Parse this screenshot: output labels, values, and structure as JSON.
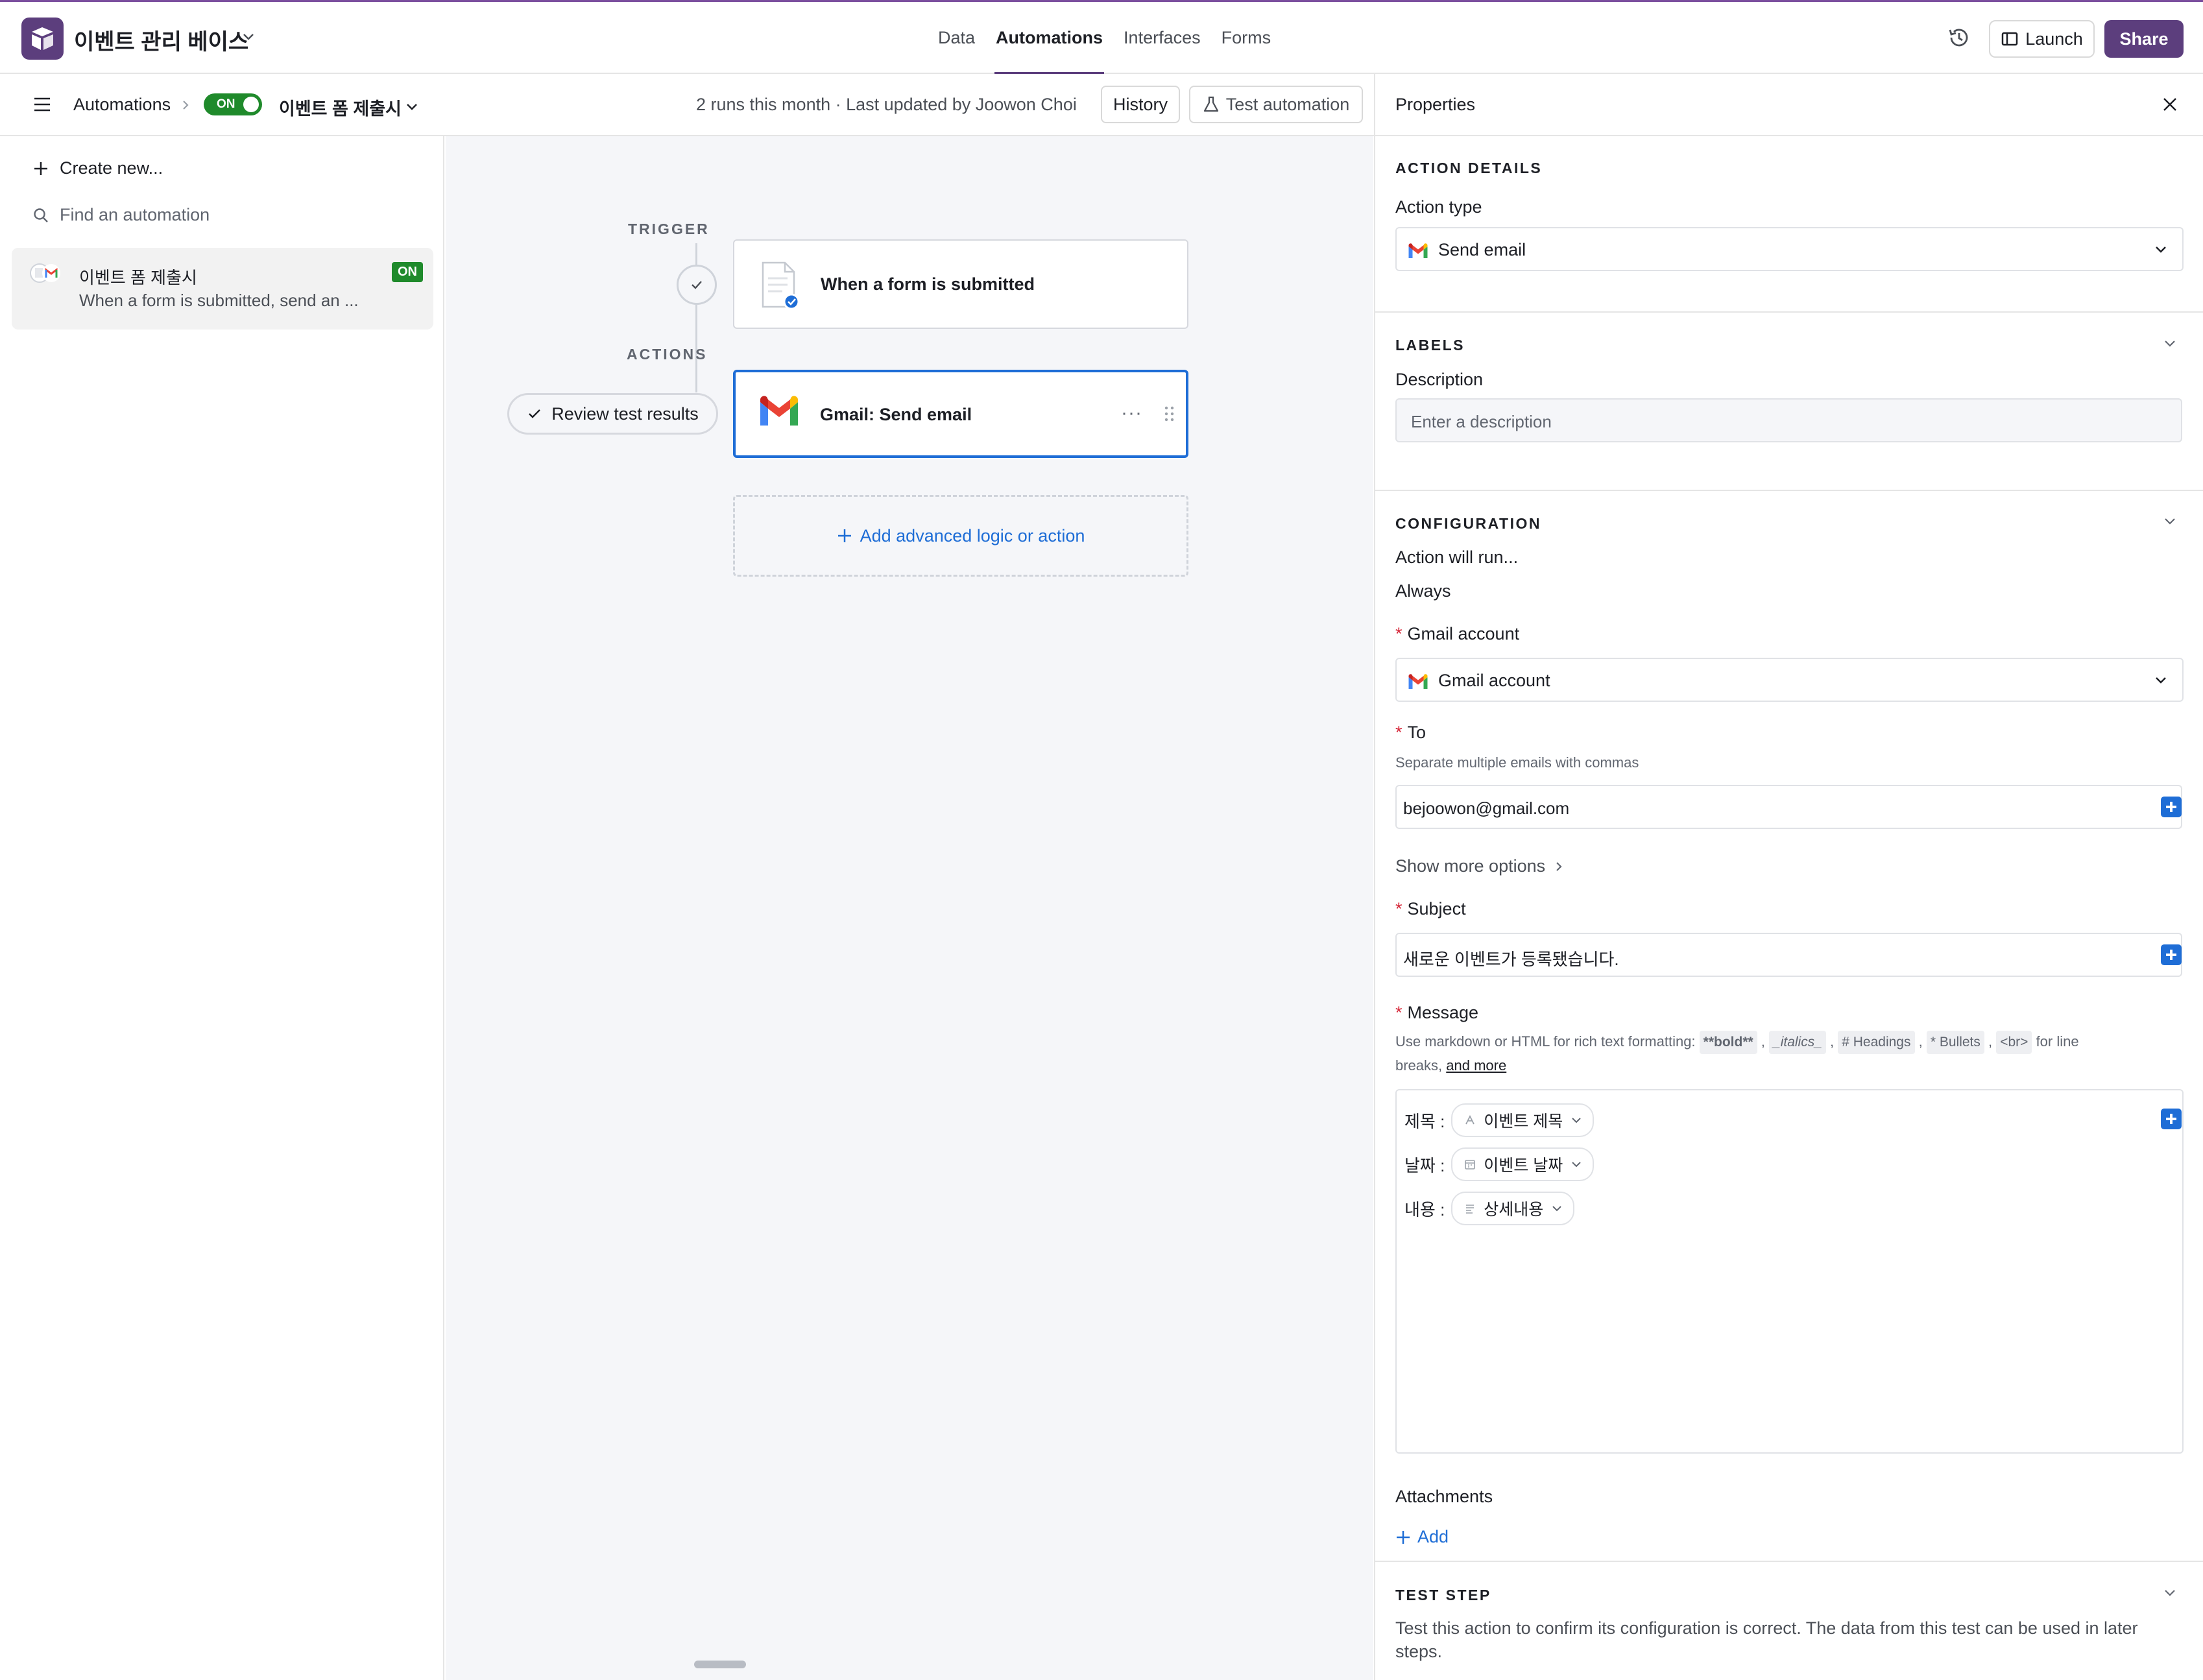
{
  "app": {
    "base_title": "이벤트 관리 베이스",
    "nav_tabs": [
      "Data",
      "Automations",
      "Interfaces",
      "Forms"
    ],
    "active_tab": "Automations",
    "launch_label": "Launch",
    "share_label": "Share",
    "brand_color": "#5c3e7d"
  },
  "subbar": {
    "crumb": "Automations",
    "toggle_label": "ON",
    "automation_name": "이벤트 폼 제출시",
    "runs_text": "2 runs this month · Last updated by Joowon Choi",
    "history_label": "History",
    "test_label": "Test automation"
  },
  "sidebar": {
    "create_new": "Create new...",
    "find_placeholder": "Find an automation",
    "items": [
      {
        "title": "이벤트 폼 제출시",
        "subtitle": "When a form is submitted, send an ...",
        "badge": "ON"
      }
    ]
  },
  "canvas": {
    "trigger_label": "TRIGGER",
    "actions_label": "ACTIONS",
    "trigger_text": "When a form is submitted",
    "action_text": "Gmail: Send email",
    "review_label": "Review test results",
    "add_logic_label": "Add advanced logic or action"
  },
  "props": {
    "title": "Properties",
    "action_details": {
      "section": "ACTION DETAILS",
      "action_type_label": "Action type",
      "action_type_value": "Send email"
    },
    "labels": {
      "section": "LABELS",
      "description_label": "Description",
      "description_placeholder": "Enter a description"
    },
    "configuration": {
      "section": "CONFIGURATION",
      "run_label": "Action will run...",
      "run_value": "Always",
      "gmail_label": "Gmail account",
      "gmail_value": "Gmail account",
      "to_label": "To",
      "to_help": "Separate multiple emails with commas",
      "to_value": "bejoowon@gmail.com",
      "show_more": "Show more options",
      "subject_label": "Subject",
      "subject_value": "새로운 이벤트가 등록됐습니다.",
      "message_label": "Message",
      "message_help_prefix": "Use markdown or HTML for rich text formatting:",
      "code_bold": "**bold**",
      "code_italics": "_italics_",
      "code_headings": "# Headings",
      "code_bullets": "* Bullets",
      "code_br": "<br>",
      "message_help_suffix": "for line",
      "message_help_line2": "breaks,",
      "and_more": "and more",
      "message_rows": [
        {
          "label": "제목 :",
          "token": "이벤트 제목",
          "icon": "text-field-icon"
        },
        {
          "label": "날짜 :",
          "token": "이벤트 날짜",
          "icon": "date-field-icon"
        },
        {
          "label": "내용 :",
          "token": "상세내용",
          "icon": "long-text-field-icon"
        }
      ],
      "attachments_label": "Attachments",
      "add_label": "Add"
    },
    "test_step": {
      "section": "TEST STEP",
      "text": "Test this action to confirm its configuration is correct. The data from this test can be used in later steps."
    }
  },
  "colors": {
    "accent_blue": "#1e6dd6",
    "on_green": "#1f8a2b",
    "required_red": "#d6283a"
  }
}
